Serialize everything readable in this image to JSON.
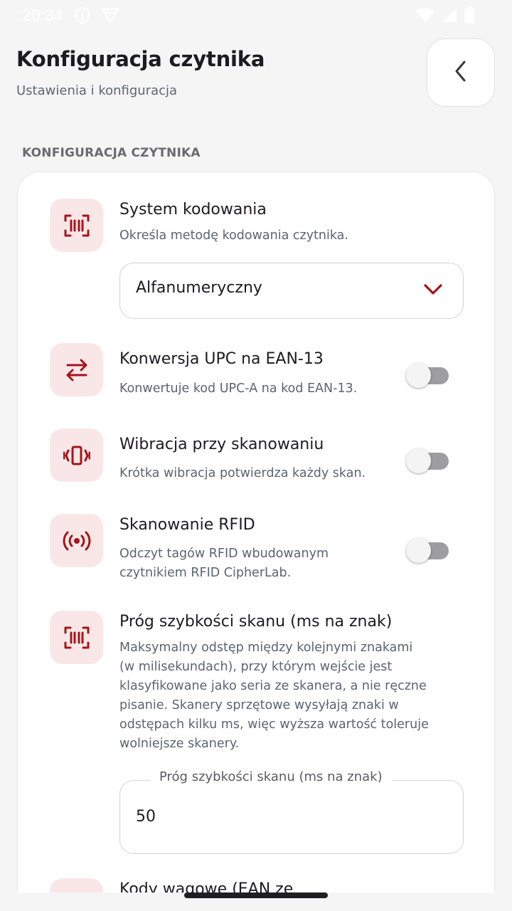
{
  "status_bar": {
    "time": "20:34"
  },
  "header": {
    "title": "Konfiguracja czytnika",
    "subtitle": "Ustawienia i konfiguracja"
  },
  "section": {
    "label": "KONFIGURACJA CZYTNIKA"
  },
  "settings": {
    "encoding": {
      "title": "System kodowania",
      "description": "Określa metodę kodowania czytnika.",
      "selected": "Alfanumeryczny"
    },
    "upc": {
      "title": "Konwersja UPC na EAN-13",
      "description": "Konwertuje kod UPC-A na kod EAN-13.",
      "enabled": false
    },
    "vibration": {
      "title": "Wibracja przy skanowaniu",
      "description": "Krótka wibracja potwierdza każdy skan.",
      "enabled": false
    },
    "rfid": {
      "title": "Skanowanie RFID",
      "description_line1": "Odczyt tagów RFID wbudowanym",
      "description_line2": "czytnikiem RFID CipherLab.",
      "enabled": false
    },
    "speed": {
      "title": "Próg szybkości skanu (ms na znak)",
      "description_lines": [
        "Maksymalny odstęp między kolejnymi znakami",
        "(w milisekundach), przy którym wejście jest",
        "klasyfikowane jako seria ze skanera, a nie ręczne",
        "pisanie. Skanery sprzętowe wysyłają znaki w",
        "odstępach kilku ms, więc wyższa wartość toleruje",
        "wolniejsze skanery."
      ],
      "field_label": "Próg szybkości skanu (ms na znak)",
      "field_value": "50"
    },
    "weight": {
      "title": "Kody wagowe (EAN ze"
    }
  },
  "colors": {
    "accent": "#a3161b",
    "icon_bg": "#f9e7e8",
    "toggle_off_track": "#9e9ea2"
  },
  "icons": {
    "encoding": "barcode-scan-icon",
    "upc": "swap-arrows-icon",
    "vibration": "vibration-icon",
    "rfid": "rfid-signal-icon",
    "speed": "barcode-scan-icon",
    "back": "chevron-left-icon",
    "select": "chevron-down-icon"
  }
}
